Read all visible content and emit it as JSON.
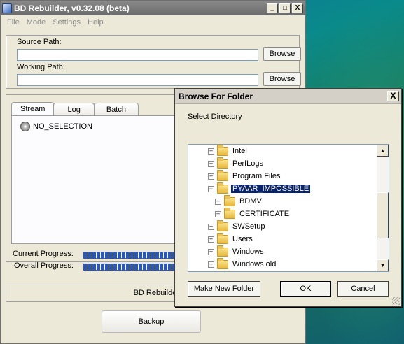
{
  "main_window": {
    "title": "BD Rebuilder, v0.32.08 (beta)",
    "menu": [
      "File",
      "Mode",
      "Settings",
      "Help"
    ],
    "source_path_label": "Source Path:",
    "source_path_value": "",
    "working_path_label": "Working Path:",
    "working_path_value": "",
    "browse_label": "Browse",
    "tabs": [
      "Stream",
      "Log",
      "Batch"
    ],
    "active_tab": "Stream",
    "stream_item": "NO_SELECTION",
    "current_progress_label": "Current Progress:",
    "overall_progress_label": "Overall Progress:",
    "rebuilder_button_label": "BD Rebuilder",
    "backup_button_label": "Backup"
  },
  "dialog": {
    "title": "Browse For Folder",
    "close_glyph": "X",
    "instruction": "Select Directory",
    "tree": [
      {
        "label": "Intel",
        "expander": "+",
        "level": 0
      },
      {
        "label": "PerfLogs",
        "expander": "+",
        "level": 0
      },
      {
        "label": "Program Files",
        "expander": "+",
        "level": 0
      },
      {
        "label": "PYAAR_IMPOSSIBLE",
        "expander": "−",
        "level": 0,
        "selected": true
      },
      {
        "label": "BDMV",
        "expander": "+",
        "level": 1
      },
      {
        "label": "CERTIFICATE",
        "expander": "+",
        "level": 1
      },
      {
        "label": "SWSetup",
        "expander": "+",
        "level": 0
      },
      {
        "label": "Users",
        "expander": "+",
        "level": 0
      },
      {
        "label": "Windows",
        "expander": "+",
        "level": 0
      },
      {
        "label": "Windows.old",
        "expander": "+",
        "level": 0
      }
    ],
    "make_new_folder_label": "Make New Folder",
    "ok_label": "OK",
    "cancel_label": "Cancel"
  },
  "title_buttons": [
    "_",
    "□",
    "X"
  ],
  "scroll_glyphs": {
    "up": "▲",
    "down": "▼"
  }
}
